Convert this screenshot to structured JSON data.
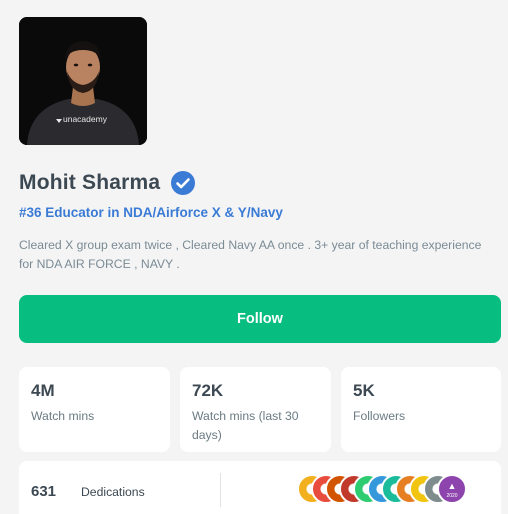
{
  "educator": {
    "name": "Mohit Sharma",
    "rank_text": "#36 Educator in NDA/Airforce X & Y/Navy",
    "bio": "Cleared X group exam twice , Cleared Navy AA once . 3+ year of teaching experience for NDA AIR FORCE , NAVY .",
    "avatar_icon": "educator-photo",
    "avatar_shirt_text": "unacademy",
    "verified_icon": "verified-check-icon"
  },
  "follow": {
    "label": "Follow",
    "color": "#08bd80"
  },
  "stats": [
    {
      "value": "4M",
      "label": "Watch mins"
    },
    {
      "value": "72K",
      "label": "Watch mins (last 30 days)"
    },
    {
      "value": "5K",
      "label": "Followers"
    }
  ],
  "dedications": {
    "count": "631",
    "label": "Dedications",
    "badge_colors": [
      "#f2b01e",
      "#e74c3c",
      "#d35400",
      "#c0392b",
      "#2ecc71",
      "#3498db",
      "#1abc9c",
      "#e67e22",
      "#f1c40f",
      "#7f8c8d",
      "#8e44ad"
    ],
    "badge_text": "2020"
  },
  "colors": {
    "accent_blue": "#3a7bd5",
    "brand_green": "#08bd80"
  }
}
